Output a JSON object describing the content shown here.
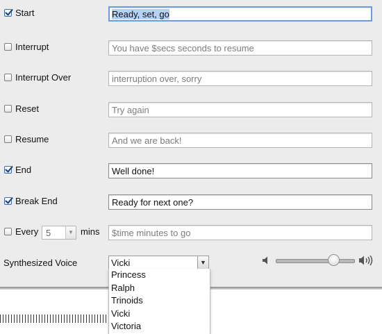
{
  "events": [
    {
      "label": "Start",
      "checked": true,
      "message": "Ready, set, go",
      "placeholder": ""
    },
    {
      "label": "Interrupt",
      "checked": false,
      "message": "",
      "placeholder": "You have $secs seconds to resume"
    },
    {
      "label": "Interrupt Over",
      "checked": false,
      "message": "",
      "placeholder": "interruption over, sorry"
    },
    {
      "label": "Reset",
      "checked": false,
      "message": "",
      "placeholder": "Try again"
    },
    {
      "label": "Resume",
      "checked": false,
      "message": "",
      "placeholder": "And we are back!"
    },
    {
      "label": "End",
      "checked": true,
      "message": "Well done!",
      "placeholder": ""
    },
    {
      "label": "Break End",
      "checked": true,
      "message": "Ready for next one?",
      "placeholder": ""
    }
  ],
  "every": {
    "label": "Every",
    "checked": false,
    "value": "5",
    "unit": "mins",
    "placeholder": "$time minutes to go"
  },
  "voice": {
    "label": "Synthesized Voice",
    "selected": "Vicki",
    "options": [
      "Princess",
      "Ralph",
      "Trinoids",
      "Vicki",
      "Victoria"
    ]
  },
  "volume": {
    "level": 0.75
  },
  "icons": {
    "dropdown_arrow": "chevron-down-icon",
    "volume_low": "speaker-low-icon",
    "volume_high": "speaker-high-icon"
  },
  "colors": {
    "focus_ring": "#6c9be0",
    "selection": "#b5d1f6",
    "checkmark": "#1f3f77"
  }
}
